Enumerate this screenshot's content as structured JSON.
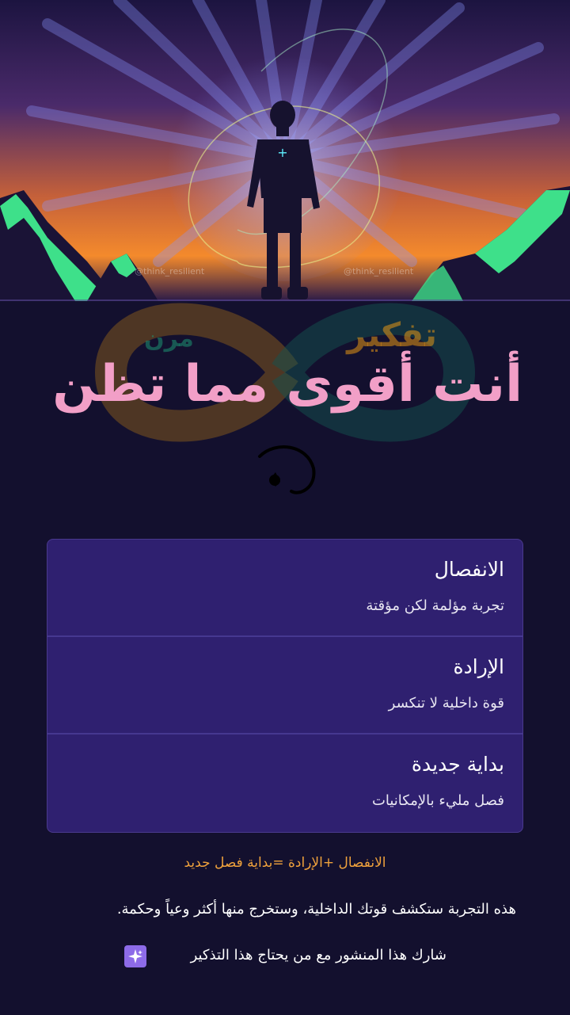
{
  "hero": {
    "handle_left": "@think_resilient",
    "handle_right": "@think_resilient",
    "colors": {
      "sky_top": "#1c1440",
      "sky_glow": "#f48a2c",
      "mountain": "#3ee08a",
      "ray": "#7f8cff"
    }
  },
  "logo": {
    "main": "تفكير",
    "sub": "مرن"
  },
  "headline": "أنت أقوى مما تظن",
  "card": {
    "rows": [
      {
        "title": "الانفصال",
        "desc": "تجربة مؤلمة لكن مؤقتة"
      },
      {
        "title": "الإرادة",
        "desc": "قوة داخلية لا تنكسر"
      },
      {
        "title": "بداية جديدة",
        "desc": "فصل مليء بالإمكانيات"
      }
    ],
    "colors": {
      "background": "#2f2070",
      "divider": "#463890"
    }
  },
  "formula": "الانفصال +الإرادة =بداية فصل جديد",
  "body_text": "هذه التجربة ستكشف قوتك الداخلية، وستخرج منها أكثر وعياً وحكمة.",
  "share_line": "شارك هذا المنشور مع من يحتاج هذا التذكير",
  "icons": {
    "share": "sparkle-icon"
  }
}
